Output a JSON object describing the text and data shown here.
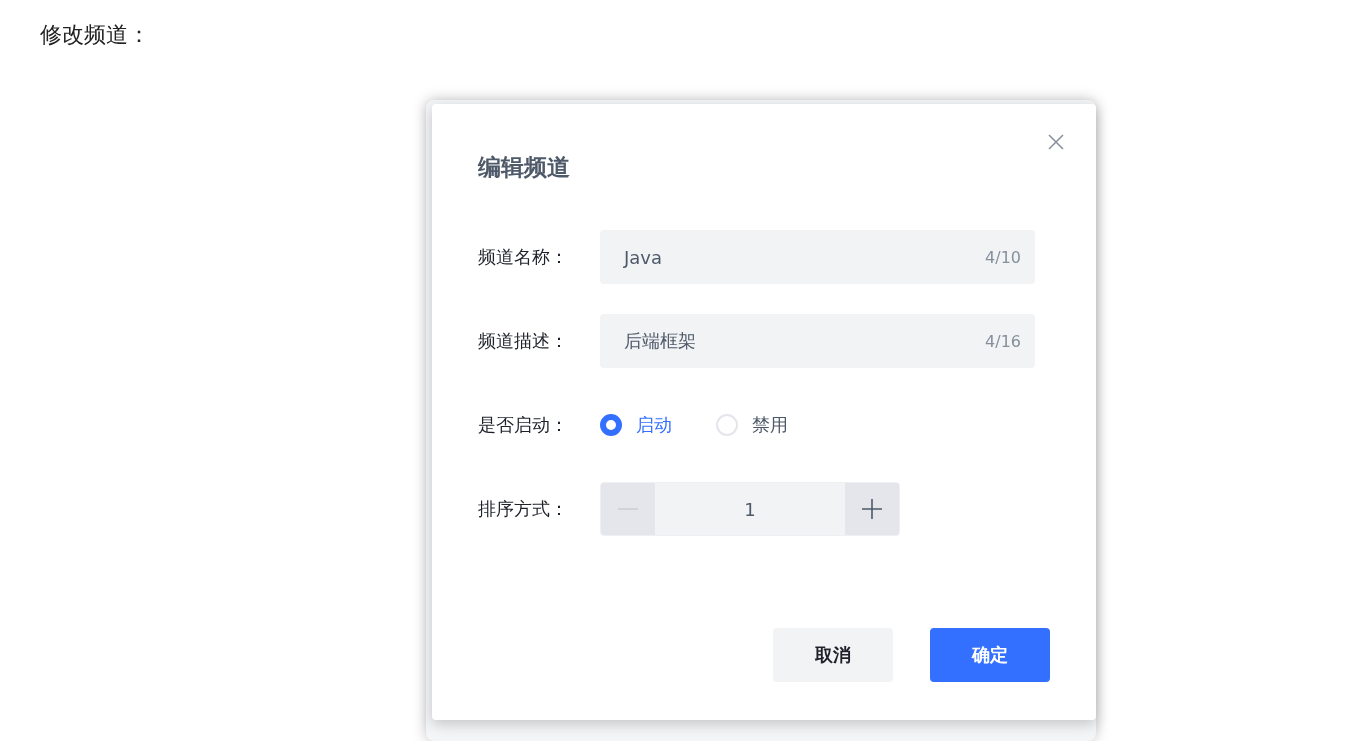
{
  "heading": "修改频道：",
  "dialog": {
    "title": "编辑频道",
    "fields": [
      {
        "label": "频道名称：",
        "value": "Java",
        "count": "4/10"
      },
      {
        "label": "频道描述：",
        "value": "后端框架",
        "count": "4/16"
      }
    ],
    "status": {
      "label": "是否启动：",
      "options": [
        {
          "label": "启动",
          "selected": true
        },
        {
          "label": "禁用",
          "selected": false
        }
      ]
    },
    "order": {
      "label": "排序方式：",
      "value": "1",
      "minus_disabled": true,
      "plus_disabled": false
    },
    "buttons": [
      {
        "label": "取消",
        "kind": "secondary"
      },
      {
        "label": "确定",
        "kind": "primary"
      }
    ]
  }
}
